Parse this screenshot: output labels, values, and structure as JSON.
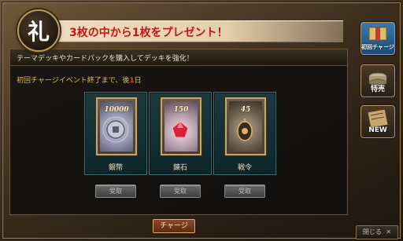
{
  "title": {
    "seal_char": "礼",
    "text": "3枚の中から1枚をプレゼント！"
  },
  "panel": {
    "description": "テーマデッキやカードパックを購入してデッキを強化！",
    "event_prefix": "初回チャージイベント終了まで、後",
    "event_days": "1",
    "event_suffix": "日"
  },
  "cards": [
    {
      "amount": "10000",
      "label": "銀幣",
      "button": "受取"
    },
    {
      "amount": "150",
      "label": "錬石",
      "button": "受取"
    },
    {
      "amount": "45",
      "label": "戦令",
      "button": "受取"
    }
  ],
  "charge_button": "チャージ",
  "side_buttons": [
    {
      "label": "初回チャージ",
      "icon": "first-charge-icon"
    },
    {
      "label": "特売",
      "icon": "special-sale-icon"
    },
    {
      "label": "NEW",
      "icon": "new-book-icon"
    }
  ],
  "close_button": "閉じる",
  "colors": {
    "title_red": "#c81414",
    "event_yellow": "#e0c24a",
    "days_red": "#e83a2a",
    "slot_teal": "#1e3a3e"
  }
}
